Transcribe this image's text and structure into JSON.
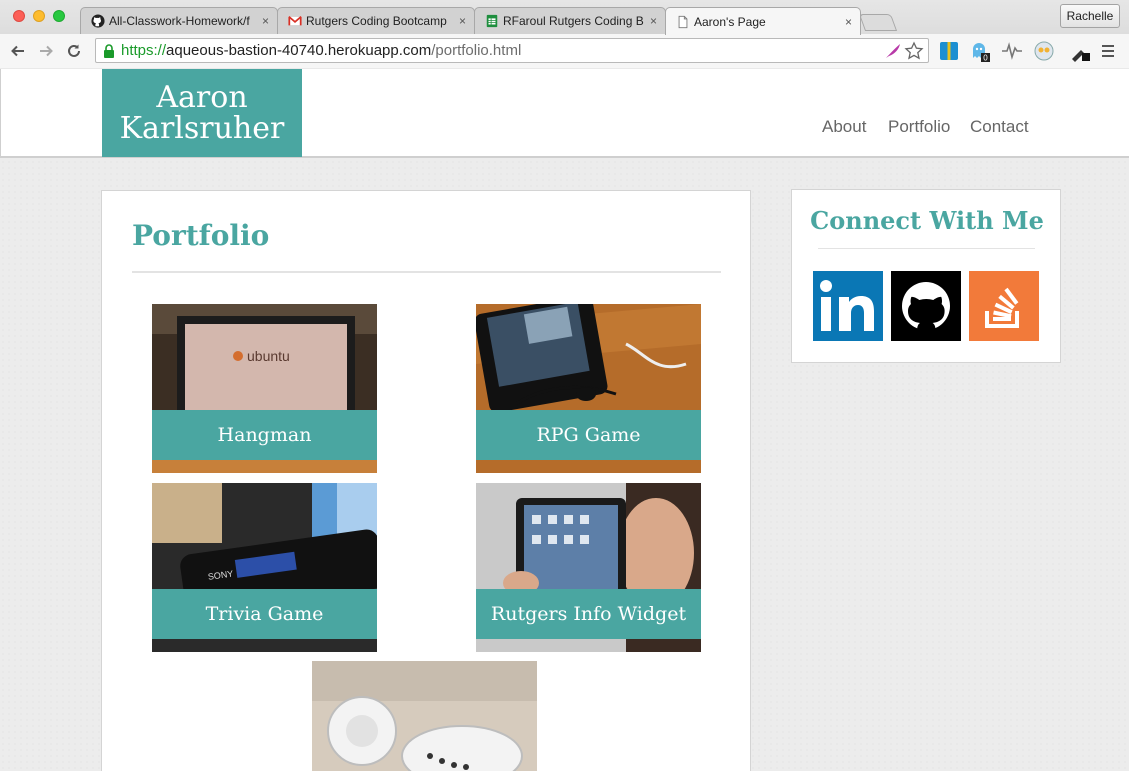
{
  "browser": {
    "tabs": [
      {
        "title": "All-Classwork-Homework/f",
        "icon": "github-icon"
      },
      {
        "title": "Rutgers Coding Bootcamp",
        "icon": "gmail-icon"
      },
      {
        "title": "RFaroul Rutgers Coding Bo",
        "icon": "sheets-icon"
      },
      {
        "title": "Aaron's Page",
        "icon": "page-icon",
        "active": true
      }
    ],
    "close_glyph": "×",
    "profile": "Rachelle",
    "url": {
      "scheme": "https://",
      "host": "aqueous-bastion-40740.herokuapp.com",
      "path": "/portfolio.html"
    },
    "extension_badge": "0"
  },
  "site": {
    "logo_line1": "Aaron",
    "logo_line2": "Karlsruher",
    "nav": [
      "About",
      "Portfolio",
      "Contact"
    ]
  },
  "portfolio": {
    "heading": "Portfolio",
    "projects": [
      {
        "title": "Hangman",
        "image": "laptop with ubuntu screen",
        "image_text": "ubuntu"
      },
      {
        "title": "RPG Game",
        "image": "smartphone with earbuds"
      },
      {
        "title": "Trivia Game",
        "image": "sony walkman player",
        "image_text": "SONY"
      },
      {
        "title": "Rutgers Info Widget",
        "image": "person holding ipad"
      },
      {
        "title": "",
        "image": "earphones on table"
      }
    ]
  },
  "connect": {
    "heading": "Connect With Me",
    "links": [
      {
        "name": "LinkedIn",
        "icon": "linkedin-icon",
        "color": "#0a77b5"
      },
      {
        "name": "GitHub",
        "icon": "github-icon",
        "color": "#000000"
      },
      {
        "name": "Stack Overflow",
        "icon": "stackoverflow-icon",
        "color": "#f48024"
      }
    ]
  },
  "colors": {
    "accent": "#4aa6a1",
    "nav_text": "#666666"
  }
}
